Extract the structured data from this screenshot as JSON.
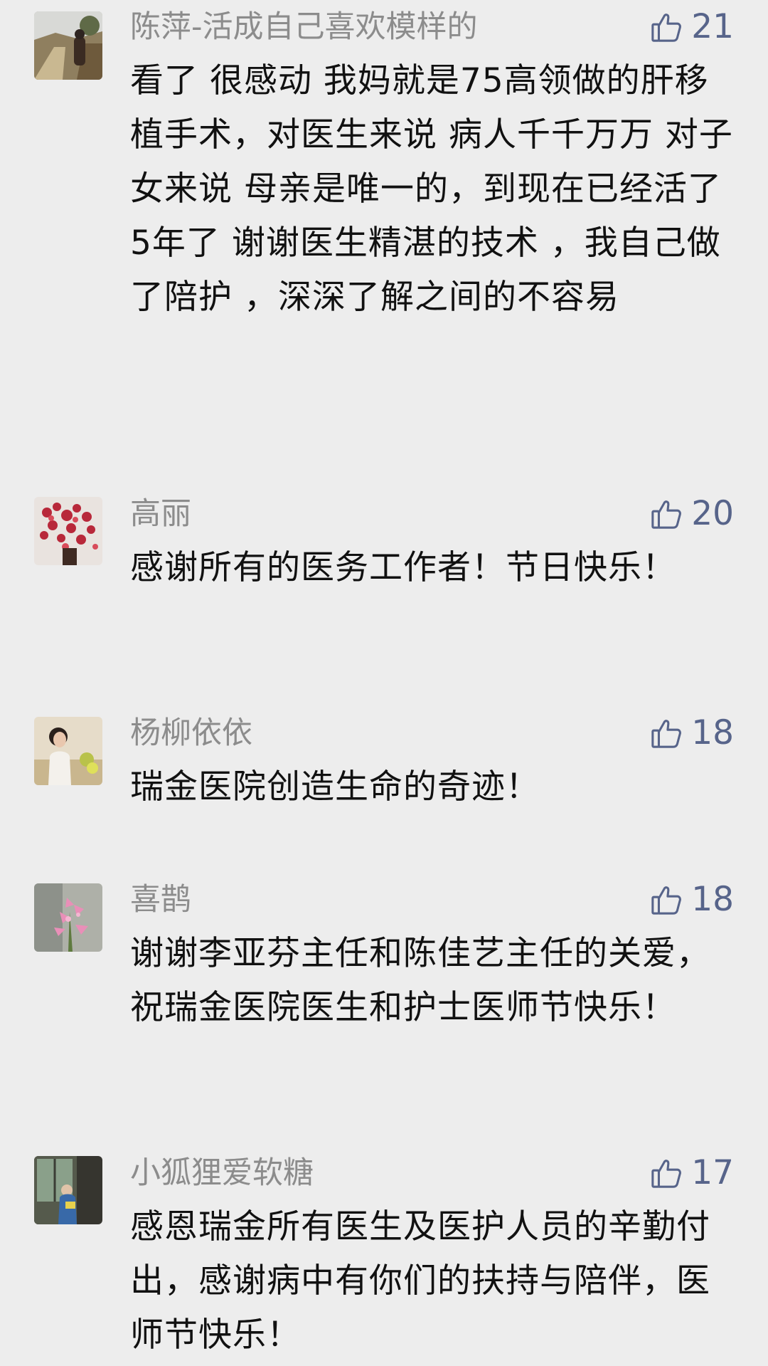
{
  "comments": [
    {
      "author": "陈萍-活成自己喜欢模样的",
      "likes": "21",
      "text": "看了 很感动 我妈就是75高领做的肝移植手术，对医生来说 病人千千万万 对子女来说 母亲是唯一的，到现在已经活了5年了 谢谢医生精湛的技术 ，我自己做了陪护 ，深深了解之间的不容易",
      "avatar_icon": "person-on-path-photo"
    },
    {
      "author": "高丽",
      "likes": "20",
      "text": "感谢所有的医务工作者！节日快乐！",
      "avatar_icon": "red-flowers-photo"
    },
    {
      "author": "杨柳依依",
      "likes": "18",
      "text": "瑞金医院创造生命的奇迹！",
      "avatar_icon": "woman-portrait-photo"
    },
    {
      "author": "喜鹊",
      "likes": "18",
      "text": "谢谢李亚芬主任和陈佳艺主任的关爱，祝瑞金医院医生和护士医师节快乐！",
      "avatar_icon": "pink-lilies-photo"
    },
    {
      "author": "小狐狸爱软糖",
      "likes": "17",
      "text": "感恩瑞金所有医生及医护人员的辛勤付出，感谢病中有你们的扶持与陪伴，医师节快乐！",
      "avatar_icon": "child-by-window-photo"
    }
  ],
  "like_icon": "thumbs-up-icon",
  "colors": {
    "background": "#ededed",
    "author": "#8c8c8c",
    "text": "#111111",
    "like": "#57648a"
  }
}
